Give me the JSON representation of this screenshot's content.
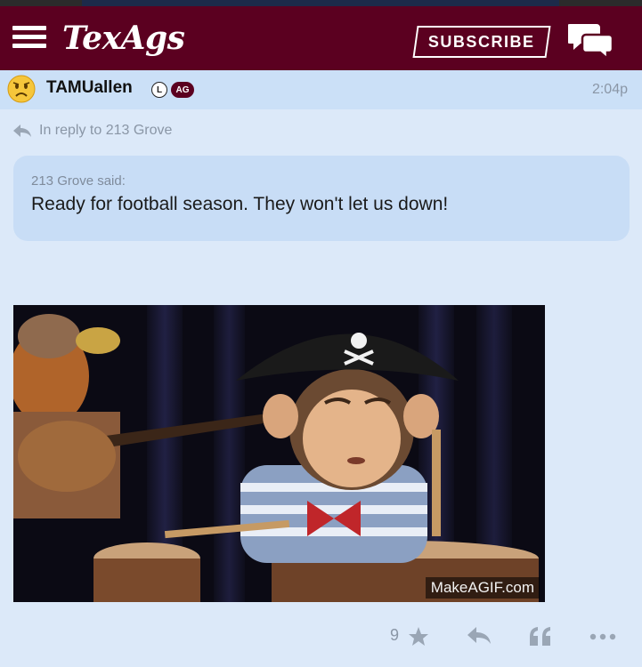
{
  "header": {
    "logo": "TexAgs",
    "subscribe_label": "SUBSCRIBE",
    "brand_color": "#5b0020"
  },
  "post": {
    "username": "TAMUallen",
    "badge_l": "L",
    "badge_ag": "AG",
    "time": "2:04p",
    "reply_text": "In reply to 213 Grove",
    "quote_author": "213 Grove said:",
    "quote_text": "Ready for football season. They won't let us down!",
    "gif_watermark": "MakeAGIF.com",
    "star_count": "9"
  },
  "icons": {
    "menu": "hamburger-menu-icon",
    "chat": "chat-bubbles-icon",
    "avatar": "worried-face-icon",
    "reply": "reply-arrow-icon",
    "star": "star-icon",
    "quote": "quote-icon",
    "more": "more-dots-icon"
  }
}
